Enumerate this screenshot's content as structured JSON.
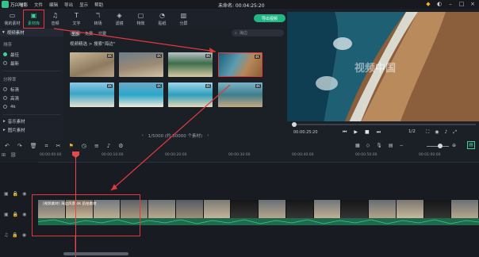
{
  "menubar": {
    "app_name": "万兴喵影",
    "items": [
      "文件",
      "编辑",
      "导出",
      "显示",
      "帮助"
    ],
    "title": "未命名: 00:04:25:20"
  },
  "toolbar": {
    "tools": [
      {
        "label": "我的素材",
        "icon": "folder-icon"
      },
      {
        "label": "素材库",
        "icon": "library-icon"
      },
      {
        "label": "音频",
        "icon": "music-icon"
      },
      {
        "label": "文字",
        "icon": "text-icon"
      },
      {
        "label": "转场",
        "icon": "transition-icon"
      },
      {
        "label": "滤镜",
        "icon": "filter-icon"
      },
      {
        "label": "特效",
        "icon": "effect-icon"
      },
      {
        "label": "贴纸",
        "icon": "sticker-icon"
      },
      {
        "label": "分屏",
        "icon": "splitscreen-icon"
      }
    ],
    "export_label": "导出视频"
  },
  "sidebar": {
    "header": "视频素材",
    "section_sort": "排序",
    "sort_items": [
      "最佳",
      "最新"
    ],
    "section_res": "分辨率",
    "res_items": [
      "标清",
      "高清",
      "4k"
    ],
    "music": "音乐素材",
    "image": "图片素材"
  },
  "media": {
    "tabs": [
      "全部",
      "免费",
      "付费"
    ],
    "search_placeholder": "海边",
    "breadcrumb": "视频精选 > 搜索\"海边\"",
    "badge": "4K",
    "pagination": "1/5000 (约 50000 个素材)"
  },
  "preview": {
    "watermark": "视频中国",
    "time": "00:00:25:20",
    "speed": "1/2"
  },
  "ruler": {
    "ticks": [
      "00:00:00:00",
      "00:00:10:00",
      "00:00:20:00",
      "00:00:30:00",
      "00:00:40:00",
      "00:00:50:00",
      "00:01:00:00"
    ]
  },
  "timeline": {
    "clip_title": "[视频素材] 海边风景 4K 航拍素材"
  },
  "colors": {
    "accent": "#3fd39b",
    "highlight": "#e23a3a",
    "playhead": "#e54a4a"
  }
}
